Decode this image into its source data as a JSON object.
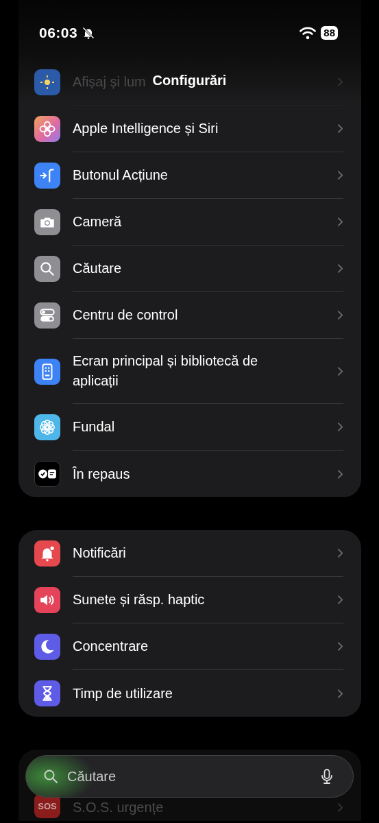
{
  "status_bar": {
    "time": "06:03",
    "battery": "88"
  },
  "title": "Configurări",
  "groups": [
    {
      "rows": [
        {
          "label": "Afișaj și lum",
          "faded": true,
          "color": "#2a5aa8"
        },
        {
          "label": "Apple Intelligence și Siri",
          "faded": false
        },
        {
          "label": "Butonul Acțiune",
          "faded": false,
          "color": "#3d83f5"
        },
        {
          "label": "Cameră",
          "faded": false,
          "color": "#8e8e93"
        },
        {
          "label": "Căutare",
          "faded": false,
          "color": "#8e8e93"
        },
        {
          "label": "Centru de control",
          "faded": false,
          "color": "#8e8e93"
        },
        {
          "label": "Ecran principal și bibliotecă de aplicații",
          "faded": false,
          "color": "#3d83f5"
        },
        {
          "label": "Fundal",
          "faded": false,
          "color": "#4fb6ea"
        },
        {
          "label": "În repaus",
          "faded": false,
          "color": "#000000"
        }
      ]
    },
    {
      "rows": [
        {
          "label": "Notificări",
          "faded": false,
          "color": "#e5484d"
        },
        {
          "label": "Sunete și răsp. haptic",
          "faded": false,
          "color": "#e5435a"
        },
        {
          "label": "Concentrare",
          "faded": false,
          "color": "#5e5ce6"
        },
        {
          "label": "Timp de utilizare",
          "faded": false,
          "color": "#5e5ce6"
        }
      ]
    },
    {
      "rows": [
        {
          "label": "S.O.S. urgențe",
          "faded": true,
          "color": "#8a1c1c",
          "icon_text": "SOS"
        }
      ]
    }
  ],
  "search": {
    "placeholder": "Căutare"
  }
}
